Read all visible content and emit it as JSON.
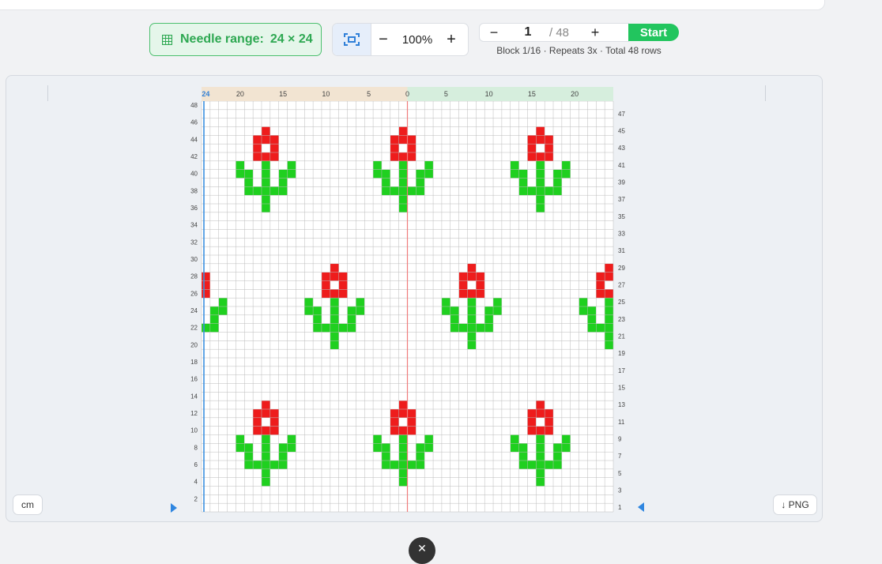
{
  "toolbar": {
    "needle_label": "Needle range:",
    "needle_value": "24 × 24",
    "zoom_minus": "−",
    "zoom_value": "100%",
    "zoom_plus": "+",
    "row_minus": "−",
    "row_value": "1",
    "row_total": "/ 48",
    "row_plus": "+",
    "start_label": "Start",
    "info_block": "Block 1/16",
    "info_repeats": "Repeats 3x",
    "info_total": "Total 48 rows",
    "info_sep": "·"
  },
  "grid": {
    "columns": 48,
    "rows": 48,
    "top_labels_left": [
      "24",
      "20",
      "15",
      "10",
      "5",
      "0"
    ],
    "top_labels_right": [
      "5",
      "10",
      "15",
      "20"
    ],
    "left_row_labels": [
      "48",
      "46",
      "44",
      "42",
      "40",
      "38",
      "36",
      "34",
      "32",
      "30",
      "28",
      "26",
      "24",
      "22",
      "20",
      "18",
      "16",
      "14",
      "12",
      "10",
      "8",
      "6",
      "4",
      "2"
    ],
    "right_row_labels": [
      "47",
      "45",
      "43",
      "41",
      "39",
      "37",
      "35",
      "33",
      "31",
      "29",
      "27",
      "25",
      "23",
      "21",
      "19",
      "17",
      "15",
      "13",
      "11",
      "9",
      "7",
      "5",
      "3",
      "1"
    ],
    "colors": {
      "flower": "#ee1c1c",
      "stem": "#1fd01f",
      "grid_line": "#bbbbbb",
      "center_line": "#f07c7c",
      "needle_line": "#3a8fe0",
      "ruler_left_bg": "#f2e4d2",
      "ruler_right_bg": "#d6eedd"
    }
  },
  "controls": {
    "unit_label": "cm",
    "export_label": "↓ PNG",
    "close_label": "✕"
  }
}
